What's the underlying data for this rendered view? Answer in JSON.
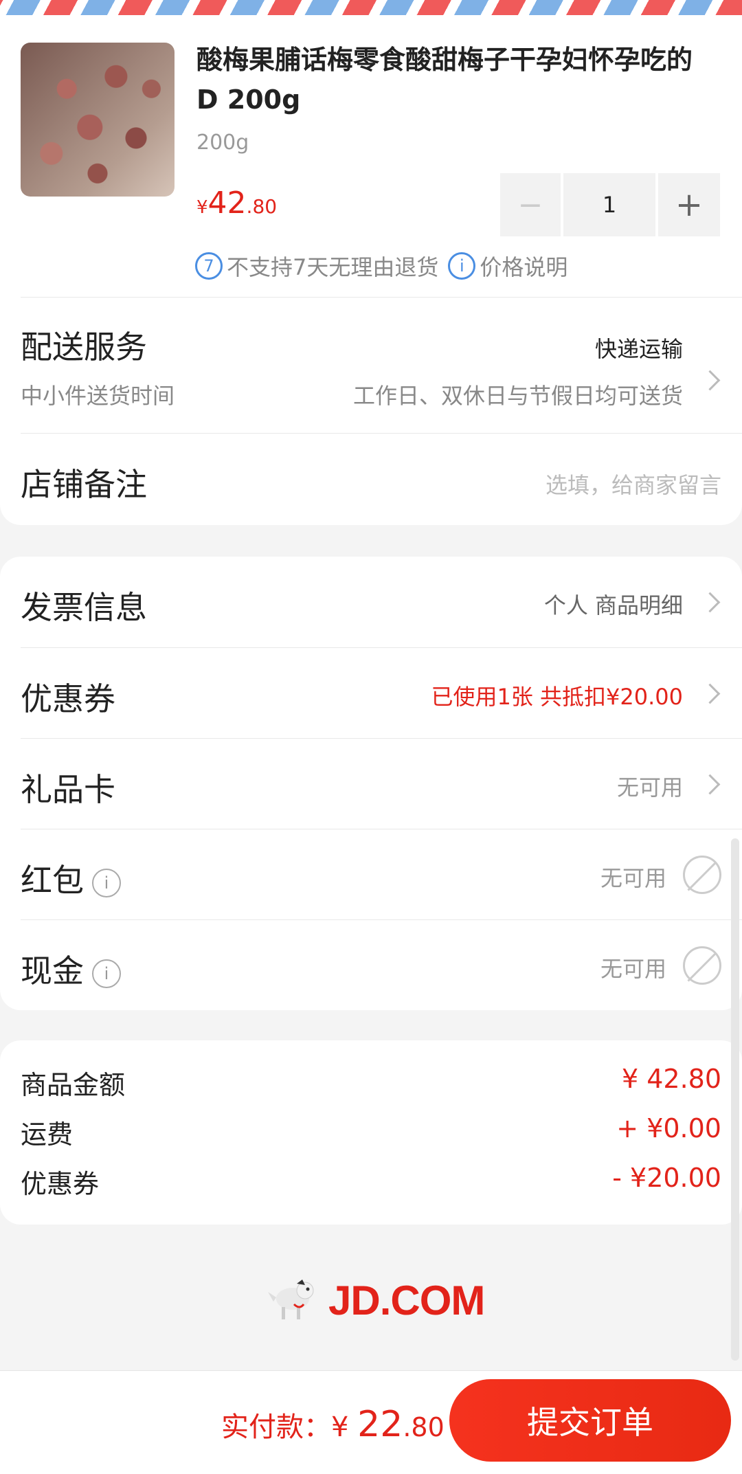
{
  "product": {
    "title": "酸梅果脯话梅零食酸甜梅子干孕妇怀孕吃的 D 200g",
    "spec": "200g",
    "price_currency": "¥",
    "price_int": "42",
    "price_dec": ".80",
    "quantity": "1",
    "minus": "−",
    "plus": "+",
    "no_return": "不支持7天无理由退货",
    "price_note": "价格说明"
  },
  "delivery": {
    "label": "配送服务",
    "method": "快递运输",
    "sub_label": "中小件送货时间",
    "sub_value": "工作日、双休日与节假日均可送货"
  },
  "remark": {
    "label": "店铺备注",
    "placeholder": "选填，给商家留言"
  },
  "options": {
    "invoice": {
      "label": "发票信息",
      "value": "个人 商品明细"
    },
    "coupon": {
      "label": "优惠券",
      "value": "已使用1张 共抵扣¥20.00"
    },
    "giftcard": {
      "label": "礼品卡",
      "value": "无可用"
    },
    "redpacket": {
      "label": "红包",
      "value": "无可用"
    },
    "cash": {
      "label": "现金",
      "value": "无可用"
    }
  },
  "summary": {
    "goods_label": "商品金额",
    "goods_value": "¥ 42.80",
    "shipping_label": "运费",
    "shipping_value": "+ ¥0.00",
    "coupon_label": "优惠券",
    "coupon_value": "- ¥20.00"
  },
  "brand": {
    "logo_text": "JD.COM"
  },
  "footer": {
    "total_label": "实付款：",
    "total_currency": "¥ ",
    "total_int": "22",
    "total_dec": ".80",
    "submit_label": "提交订单"
  },
  "colors": {
    "accent": "#e2231a",
    "info_blue": "#4a8ee2"
  }
}
